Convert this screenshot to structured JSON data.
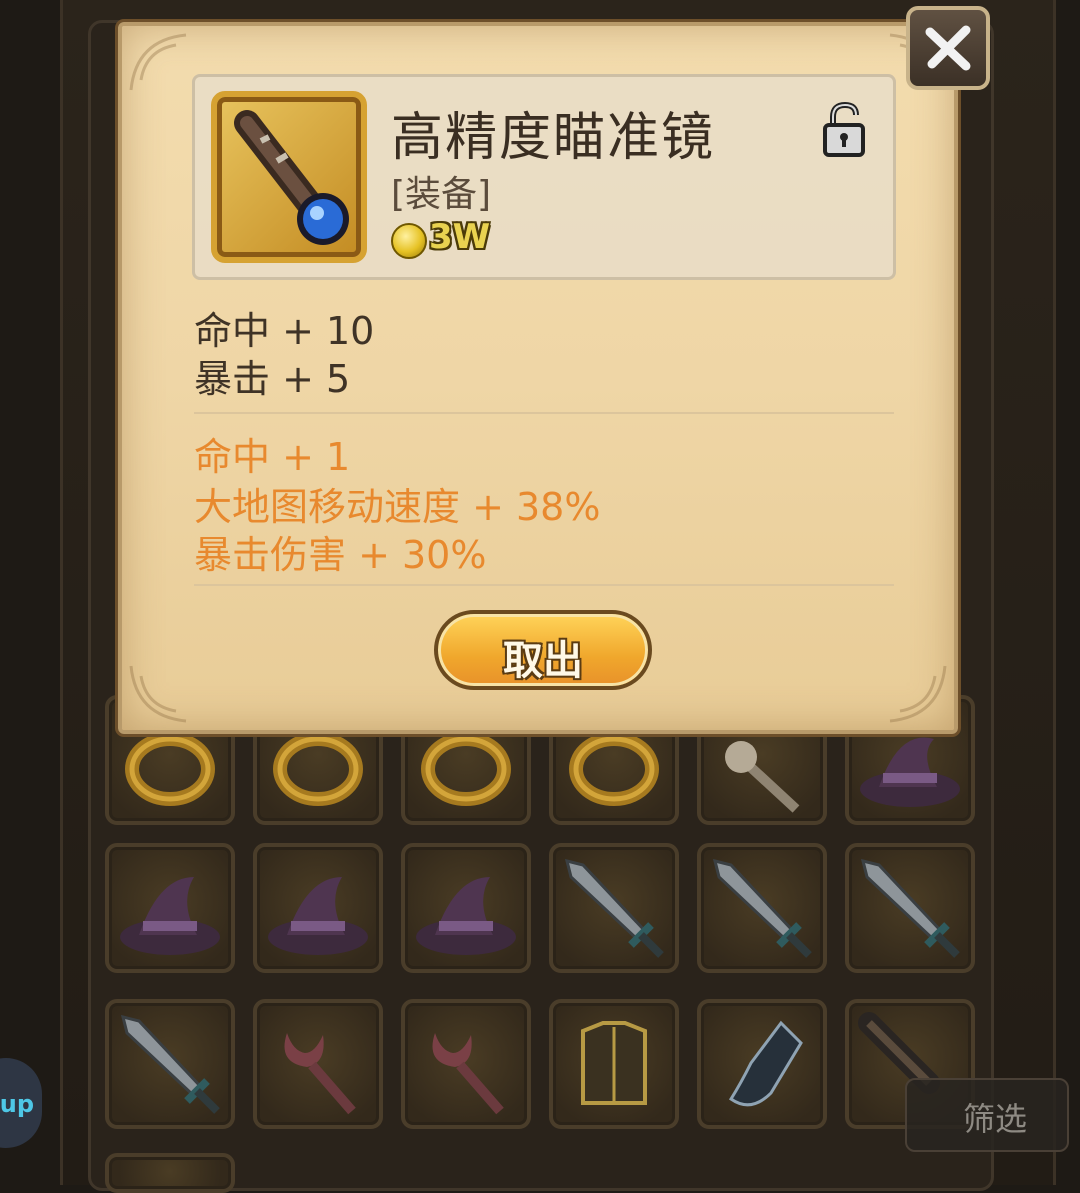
{
  "item": {
    "title": "高精度瞄准镜",
    "category": "[装备]",
    "price": "3W",
    "icon": "spyglass-icon",
    "locked": false
  },
  "base_stats": [
    "命中 + 10",
    "暴击 + 5"
  ],
  "bonus_stats": [
    "命中 + 1",
    "大地图移动速度 + 38%",
    "暴击伤害 + 30%"
  ],
  "actions": {
    "take_out_label": "取出"
  },
  "filter": {
    "label": "筛选"
  },
  "side_bubble": {
    "label": "up"
  },
  "inventory": [
    [
      "ring-icon",
      "ring-icon",
      "ring-icon",
      "ring-icon",
      "staff-icon",
      "wizard-hat-icon"
    ],
    [
      "wizard-hat-icon",
      "wizard-hat-icon",
      "wizard-hat-icon",
      "sword-icon",
      "sword-icon",
      "sword-icon"
    ],
    [
      "sword-icon",
      "claw-staff-icon",
      "claw-staff-icon",
      "armor-icon",
      "gauntlet-icon",
      "spyglass-icon"
    ]
  ],
  "colors": {
    "panel": "#efd6a6",
    "title_text": "#3a2e22",
    "bonus_text": "#e8892e",
    "button": "#f0a72c",
    "coin": "#e6c224"
  }
}
